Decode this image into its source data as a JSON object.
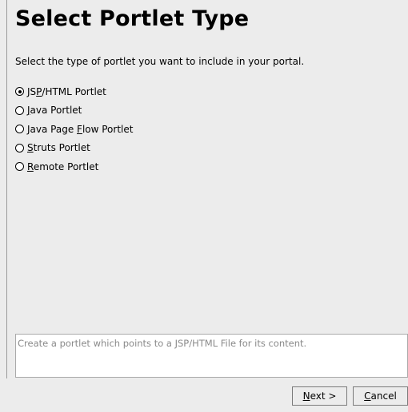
{
  "dialog": {
    "title": "Select Portlet Type",
    "description": "Select the type of portlet you want to include in your portal.",
    "options": [
      {
        "pre": "JS",
        "mn": "P",
        "post": "/HTML Portlet",
        "selected": true
      },
      {
        "pre": "",
        "mn": "J",
        "post": "ava Portlet",
        "selected": false
      },
      {
        "pre": "Java Page ",
        "mn": "F",
        "post": "low Portlet",
        "selected": false
      },
      {
        "pre": "",
        "mn": "S",
        "post": "truts Portlet",
        "selected": false
      },
      {
        "pre": "",
        "mn": "R",
        "post": "emote Portlet",
        "selected": false
      }
    ],
    "info": "Create a portlet which points to a JSP/HTML File for its content."
  },
  "buttons": {
    "next": {
      "mn": "N",
      "post": "ext >"
    },
    "cancel": {
      "mn": "C",
      "post": "ancel"
    }
  }
}
